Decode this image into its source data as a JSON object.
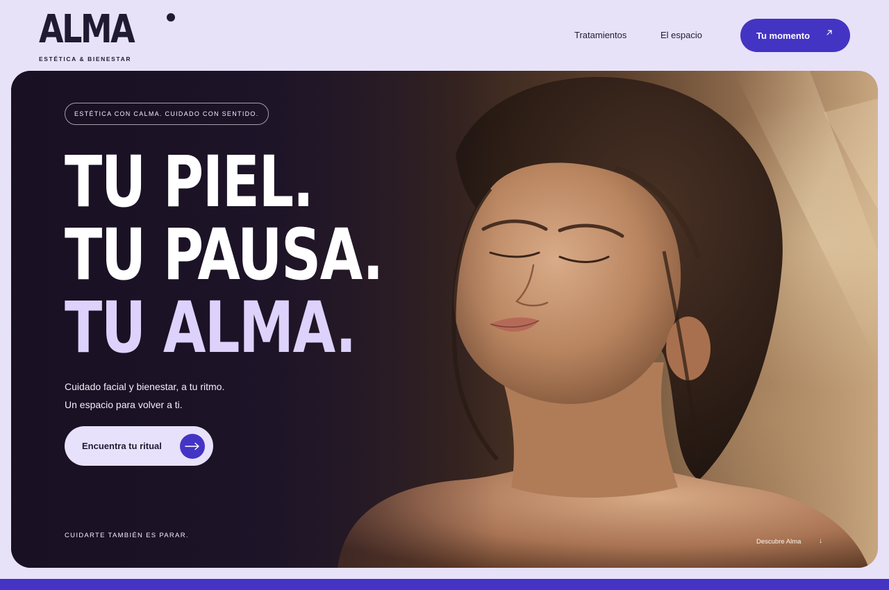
{
  "brand": {
    "name": "ALMA",
    "tagline": "ESTÉTICA & BIENESTAR"
  },
  "nav": {
    "items": [
      {
        "label": "Tratamientos"
      },
      {
        "label": "El espacio"
      }
    ],
    "cta": {
      "label": "Tu momento",
      "icon": "arrow-up-right-icon"
    }
  },
  "hero": {
    "pill": "ESTÉTICA CON CALMA. CUIDADO CON SENTIDO.",
    "headline": [
      "TU PIEL.",
      "TU PAUSA.",
      "TU ALMA."
    ],
    "subtitle": [
      "Cuidado facial y bienestar, a tu ritmo.",
      "Un espacio para volver a ti."
    ],
    "cta": {
      "label": "Encuentra tu ritual",
      "icon": "arrow-right-icon"
    },
    "footer_left": "CUIDARTE TAMBIÉN ES PARAR.",
    "footer_right": {
      "label": "Descubre Alma",
      "icon": "arrow-down-icon"
    }
  },
  "colors": {
    "page_bg": "#e7e2f8",
    "brand_purple": "#4434c4",
    "dark_text": "#1f1b33",
    "accent_lavender": "#ddd2fb"
  }
}
